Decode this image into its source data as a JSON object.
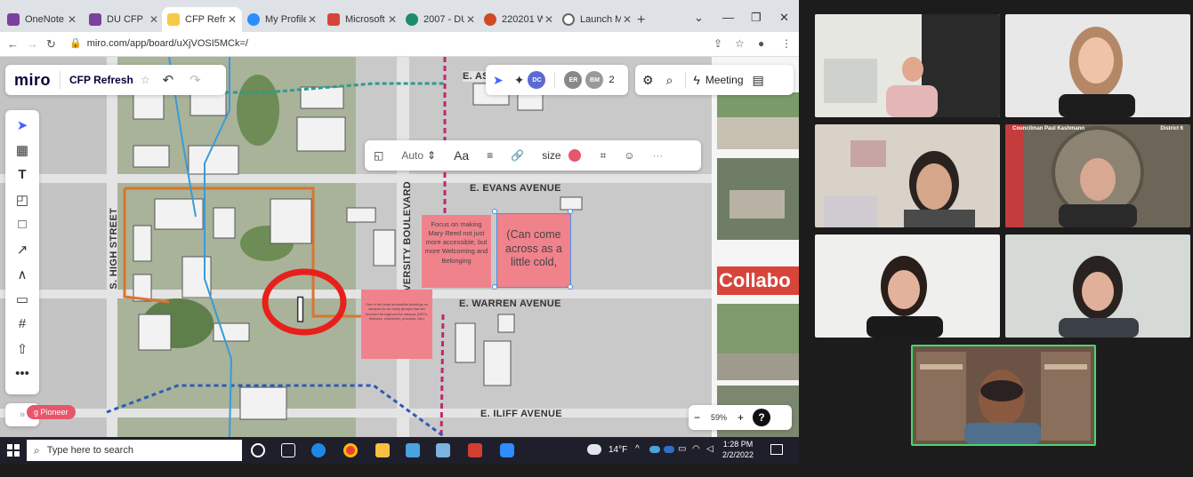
{
  "browser": {
    "tabs": [
      {
        "label": "OneNote",
        "color": "#7b3fa0"
      },
      {
        "label": "DU CFP",
        "color": "#7b3fa0"
      },
      {
        "label": "CFP Refresh",
        "color": "#f7c948"
      },
      {
        "label": "My Profile",
        "color": "#2d8cff"
      },
      {
        "label": "Microsoft",
        "color": "#d9443a"
      },
      {
        "label": "2007 - DU",
        "color": "#1c8c6c"
      },
      {
        "label": "220201 W",
        "color": "#d04a24"
      },
      {
        "label": "Launch Me",
        "color": "#666666"
      }
    ],
    "url": "miro.com/app/board/uXjVOSI5MCk=/"
  },
  "miro": {
    "logo": "miro",
    "board_title": "CFP Refresh",
    "avatars": [
      {
        "initials": "DC",
        "color": "#5b6bd1"
      },
      {
        "initials": "ER",
        "color": "#888888"
      },
      {
        "initials": "BM",
        "color": "#999999"
      }
    ],
    "participant_count": "2",
    "meeting_label": "Meeting",
    "context_toolbar": {
      "font_mode": "Auto",
      "font_icon_text": "Aa",
      "size_label": "size"
    },
    "zoom": {
      "percent": "59%",
      "minus": "−",
      "plus": "+",
      "help": "?"
    },
    "tag_label": "g Pioneer",
    "expander": "»",
    "streets": {
      "e_as": "E. AS",
      "evans": "E. EVANS AVENUE",
      "warren": "E. WARREN AVENUE",
      "iliff": "E. ILIFF AVENUE",
      "high": "S. HIGH STREET",
      "university": "UNIVERSITY BOULEVARD"
    },
    "stickies": {
      "one": "Focus on making Mary Reed not just more accessible, but more Welcoming and Belonging",
      "two": "(Can come across as a little cold,",
      "three": "One of the least accessible buildings on campus for as many groups that are involved throughout the campus (DEI's, finances, chancellor, provosts, etc.)"
    },
    "map_letter": "I",
    "collab_banner": "Collabo"
  },
  "taskbar": {
    "search_placeholder": "Type here to search",
    "weather": "14°F",
    "time": "1:28 PM",
    "date": "2/2/2022"
  },
  "zoom_gallery": {
    "tile_caption_left": "Councilman Paul Kashmann",
    "tile_caption_right": "District 6"
  }
}
